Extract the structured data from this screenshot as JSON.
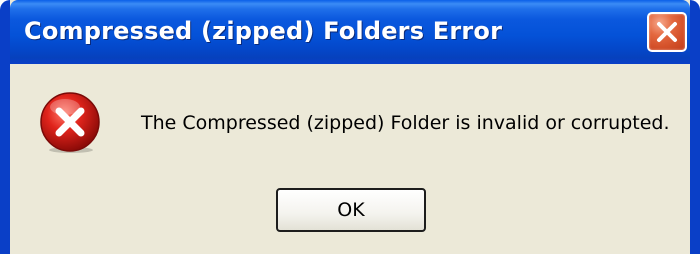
{
  "dialog": {
    "title": "Compressed (zipped) Folders Error",
    "message": "The Compressed (zipped) Folder is invalid or corrupted.",
    "icon": "error-icon",
    "close_icon": "close-icon",
    "ok_label": "OK"
  },
  "colors": {
    "titlebar": "#0452d8",
    "dialog_background": "#ece9d8",
    "close_button": "#d4512a",
    "error_icon": "#c81414"
  }
}
